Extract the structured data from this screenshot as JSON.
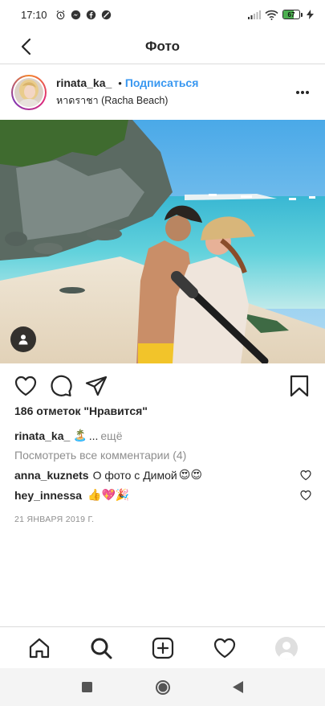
{
  "status_bar": {
    "time": "17:10",
    "battery_percent": 67,
    "battery_label": "67",
    "icons": [
      "alarm-icon",
      "messenger-icon",
      "facebook-icon",
      "dnd-icon",
      "signal-icon",
      "wifi-icon",
      "battery-icon",
      "charging-icon"
    ]
  },
  "header": {
    "title": "Фото",
    "back_icon": "chevron-left-icon"
  },
  "post": {
    "username": "rinata_ka_",
    "separator": "•",
    "follow_label": "Подписаться",
    "location": "หาดราชา (Racha Beach)",
    "more_icon": "ellipsis-icon",
    "photo_tag_icon": "user-tag-icon",
    "likes_text": "186 отметок \"Нравится\"",
    "caption_username": "rinata_ka_",
    "caption_emoji": "🏝️",
    "caption_ellipsis": "...",
    "caption_more": "ещё",
    "view_comments": "Посмотреть все комментарии (4)",
    "comments": [
      {
        "username": "anna_kuznets",
        "text": "О фото с Димой",
        "emoji": "😍😍"
      },
      {
        "username": "hey_innessa",
        "text": "",
        "emoji": "👍💖🎉"
      }
    ],
    "date": "21 ЯНВАРЯ 2019 Г."
  },
  "actions": {
    "like_icon": "heart-icon",
    "comment_icon": "comment-icon",
    "share_icon": "share-icon",
    "save_icon": "bookmark-icon"
  },
  "bottom_nav": {
    "items": [
      "home-icon",
      "search-icon",
      "new-post-icon",
      "activity-icon",
      "profile-avatar"
    ]
  },
  "system_nav": {
    "items": [
      "recents-square",
      "home-circle",
      "back-triangle"
    ]
  }
}
